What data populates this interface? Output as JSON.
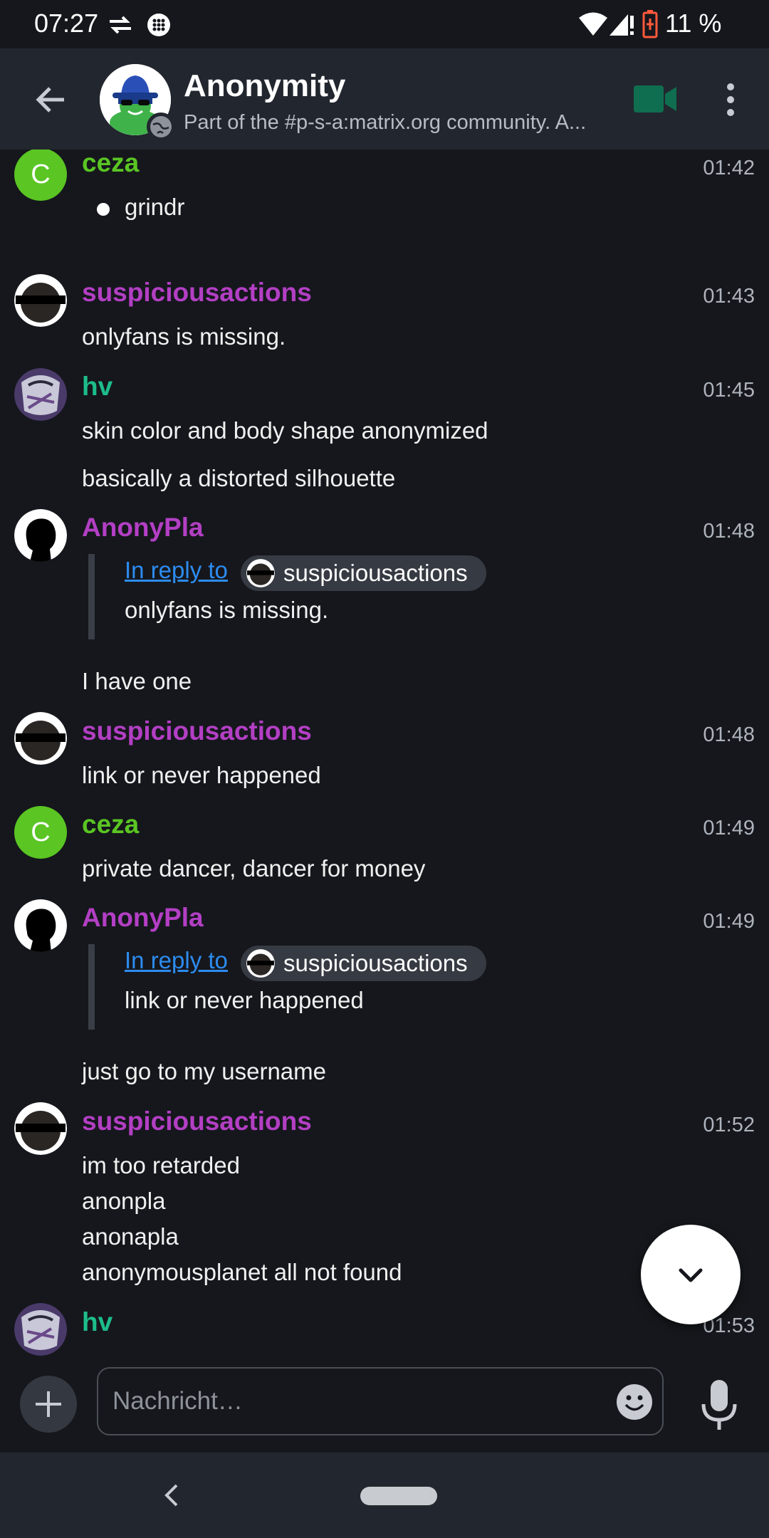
{
  "status_bar": {
    "time": "07:27",
    "battery_percent": "11 %",
    "icons": [
      "data-transfer-icon",
      "grid-dots-icon",
      "wifi-icon",
      "cell-signal-icon",
      "battery-low-icon"
    ]
  },
  "header": {
    "title": "Anonymity",
    "subtitle": "Part of the #p-s-a:matrix.org community. A..."
  },
  "messages": [
    {
      "sender": "ceza",
      "time": "01:42",
      "bullet": "grindr"
    },
    {
      "sender": "suspiciousactions",
      "time": "01:43",
      "lines": [
        "onlyfans is missing."
      ]
    },
    {
      "sender": "hv",
      "time": "01:45",
      "lines": [
        "skin color and body shape anonymized",
        "basically a distorted silhouette"
      ]
    },
    {
      "sender": "AnonyPla",
      "time": "01:48",
      "reply": {
        "link": "In reply to",
        "to": "suspiciousactions",
        "quote": "onlyfans is missing."
      },
      "lines": [
        "I have one"
      ]
    },
    {
      "sender": "suspiciousactions",
      "time": "01:48",
      "lines": [
        "link or never happened"
      ]
    },
    {
      "sender": "ceza",
      "time": "01:49",
      "lines": [
        "private dancer, dancer for money"
      ]
    },
    {
      "sender": "AnonyPla",
      "time": "01:49",
      "reply": {
        "link": "In reply to",
        "to": "suspiciousactions",
        "quote": "link or never happened"
      },
      "lines": [
        "just go to my username"
      ]
    },
    {
      "sender": "suspiciousactions",
      "time": "01:52",
      "lines": [
        "im too retarded",
        "anonpla",
        "anonapla",
        "anonymousplanet all not found"
      ]
    },
    {
      "sender": "hv",
      "time": "01:53",
      "lines": []
    }
  ],
  "avatar_letters": {
    "ceza": "C"
  },
  "composer": {
    "placeholder": "Nachricht…"
  },
  "colors": {
    "background": "#15171c",
    "appbar": "#22262e",
    "sender_purple": "#b33fc4",
    "sender_green": "#5ac523",
    "sender_teal": "#1dbd8a",
    "link_blue": "#2d8cf0",
    "video_green": "#0f6e4f"
  }
}
